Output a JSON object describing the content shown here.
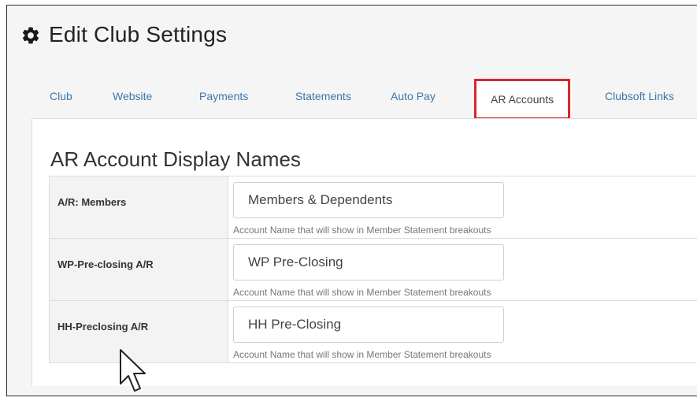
{
  "page": {
    "title": "Edit Club Settings",
    "title_icon": "gear-icon"
  },
  "tabs": [
    {
      "label": "Club",
      "active": false
    },
    {
      "label": "Website",
      "active": false
    },
    {
      "label": "Payments",
      "active": false
    },
    {
      "label": "Statements",
      "active": false
    },
    {
      "label": "Auto Pay",
      "active": false
    },
    {
      "label": "AR Accounts",
      "active": true
    },
    {
      "label": "Clubsoft Links",
      "active": false
    }
  ],
  "section": {
    "title": "AR Account Display Names"
  },
  "fields": [
    {
      "label": "A/R: Members",
      "value": "Members & Dependents",
      "help": "Account Name that will show in Member Statement breakouts"
    },
    {
      "label": "WP-Pre-closing A/R",
      "value": "WP Pre-Closing",
      "help": "Account Name that will show in Member Statement breakouts"
    },
    {
      "label": "HH-Preclosing A/R",
      "value": "HH Pre-Closing",
      "help": "Account Name that will show in Member Statement breakouts"
    }
  ],
  "colors": {
    "link": "#3e75a8",
    "highlight": "#d9262b",
    "panel_bg": "#f5f5f5"
  }
}
